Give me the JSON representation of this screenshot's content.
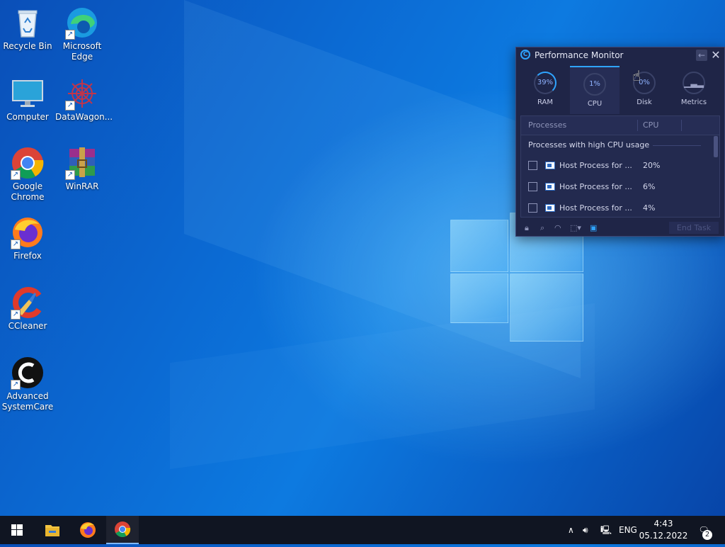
{
  "desktop": {
    "icons": [
      {
        "label": "Recycle Bin",
        "icon": "recycle-bin-icon"
      },
      {
        "label": "Microsoft Edge",
        "icon": "edge-icon"
      },
      {
        "label": "Computer",
        "icon": "computer-icon"
      },
      {
        "label": "DataWagon...",
        "icon": "datawagon-icon"
      },
      {
        "label": "Google Chrome",
        "icon": "chrome-icon"
      },
      {
        "label": "WinRAR",
        "icon": "winrar-icon"
      },
      {
        "label": "Firefox",
        "icon": "firefox-icon"
      },
      {
        "label": "CCleaner",
        "icon": "ccleaner-icon"
      },
      {
        "label": "Advanced SystemCare",
        "icon": "advanced-systemcare-icon"
      }
    ]
  },
  "perf_monitor": {
    "title": "Performance Monitor",
    "tabs": [
      {
        "label": "RAM",
        "value": "39%"
      },
      {
        "label": "CPU",
        "value": "1%"
      },
      {
        "label": "Disk",
        "value": "0%"
      },
      {
        "label": "Metrics",
        "value": ""
      }
    ],
    "active_tab": "CPU",
    "columns": [
      "Processes",
      "CPU"
    ],
    "group_label": "Processes with high CPU usage",
    "rows": [
      {
        "name": "Host Process for ...",
        "cpu": "20%"
      },
      {
        "name": "Host Process for ...",
        "cpu": "6%"
      },
      {
        "name": "Host Process for ...",
        "cpu": "4%"
      }
    ],
    "end_task_label": "End Task"
  },
  "taskbar": {
    "pinned": [
      "start-button",
      "file-explorer-icon",
      "firefox-icon",
      "chrome-icon"
    ],
    "language": "ENG",
    "time": "4:43",
    "date": "05.12.2022",
    "notification_count": "2"
  },
  "colors": {
    "accent": "#2fa4ff",
    "monitor_bg": "#1f2547",
    "taskbar_bg": "#101522"
  }
}
